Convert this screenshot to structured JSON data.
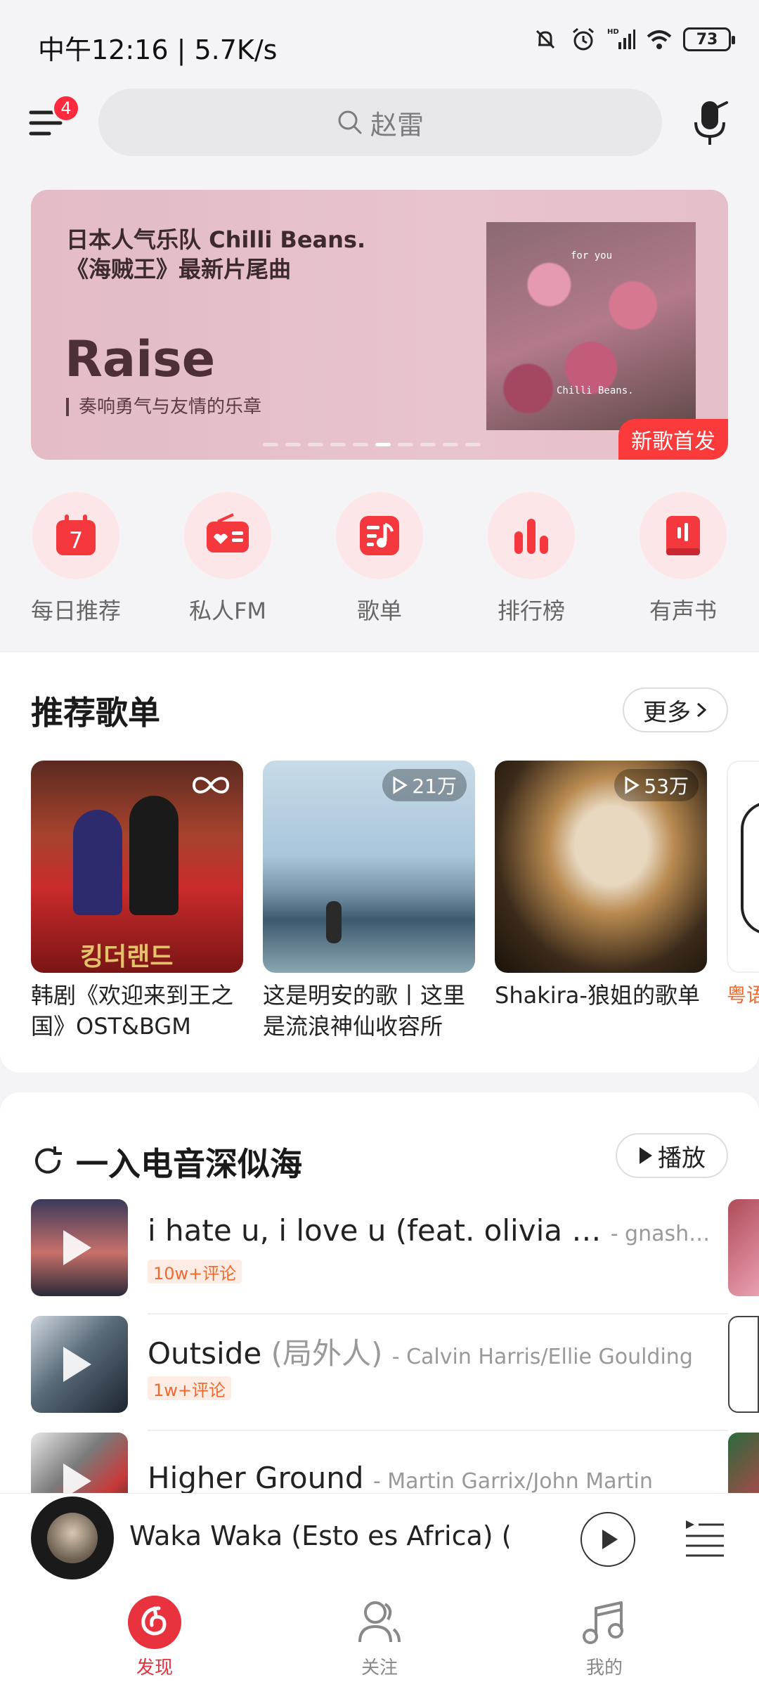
{
  "status": {
    "time": "中午12:16 | 5.7K/s",
    "battery": "73"
  },
  "header": {
    "menu_badge": "4",
    "search_placeholder": "赵雷"
  },
  "banner": {
    "subtitle_line1": "日本人气乐队 Chilli Beans.",
    "subtitle_line2": "《海贼王》最新片尾曲",
    "title": "Raise",
    "desc": "奏响勇气与友情的乐章",
    "tag": "新歌首发",
    "cover_text_top": "for you",
    "cover_text_bottom": "Chilli Beans."
  },
  "quick_entries": [
    {
      "label": "每日推荐",
      "icon": "calendar-icon",
      "day": "7"
    },
    {
      "label": "私人FM",
      "icon": "radio-icon"
    },
    {
      "label": "歌单",
      "icon": "playlist-icon"
    },
    {
      "label": "排行榜",
      "icon": "chart-icon"
    },
    {
      "label": "有声书",
      "icon": "audiobook-icon"
    }
  ],
  "recommend": {
    "title": "推荐歌单",
    "more": "更多",
    "playlists": [
      {
        "name": "韩剧《欢迎来到王之国》OST&BGM",
        "count": "",
        "cover_text": "킹더랜드"
      },
      {
        "name": "这是明安的歌丨这里是流浪神仙收容所",
        "count": "21万"
      },
      {
        "name": "Shakira-狼姐的歌单",
        "count": "53万"
      },
      {
        "name": "粤语舞"
      }
    ]
  },
  "radar": {
    "title": "一入电音深似海",
    "play": "播放",
    "songs": [
      {
        "title": "i hate u, i love u (feat. olivia …",
        "artist": "- gnash…",
        "tag": "10w+评论"
      },
      {
        "title": "Outside",
        "alias": "(局外人)",
        "artist": "- Calvin Harris/Ellie Goulding",
        "tag": "1w+评论"
      },
      {
        "title": "Higher Ground",
        "artist": "- Martin Garrix/John Martin"
      }
    ]
  },
  "player": {
    "title": "Waka Waka (Esto es Africa) (…"
  },
  "nav": [
    {
      "label": "发现",
      "icon": "discover-icon",
      "active": true
    },
    {
      "label": "关注",
      "icon": "follow-icon"
    },
    {
      "label": "我的",
      "icon": "music-note-icon"
    }
  ],
  "colors": {
    "accent": "#e8323e",
    "tag": "#fb3b3b"
  }
}
